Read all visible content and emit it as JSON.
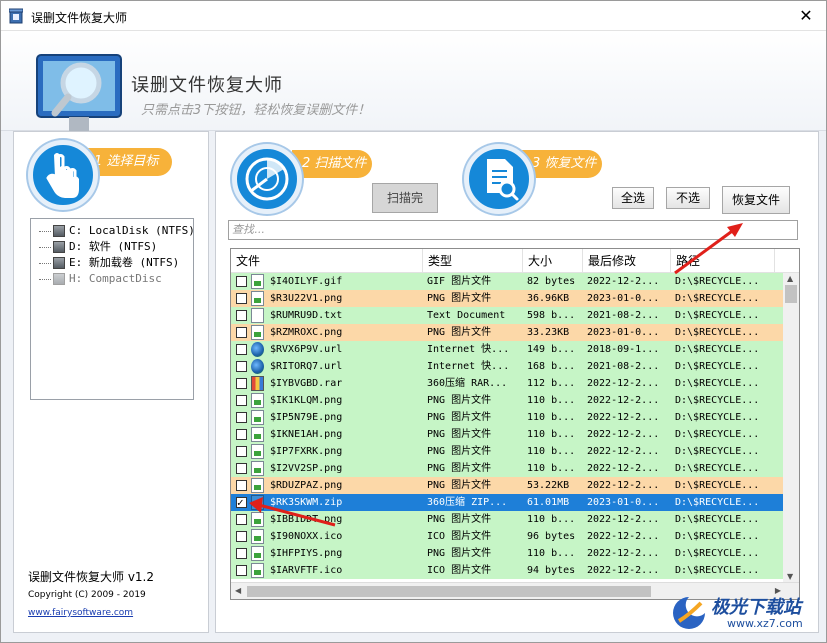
{
  "window": {
    "title": "误删文件恢复大师",
    "close_label": "✕"
  },
  "header": {
    "title": "误删文件恢复大师",
    "subtitle": "只需点击3下按钮，轻松恢复误删文件！"
  },
  "steps": {
    "step1": "1 选择目标",
    "step2": "2 扫描文件",
    "step3": "3 恢复文件"
  },
  "drives": [
    {
      "label": "C: LocalDisk (NTFS)",
      "enabled": true
    },
    {
      "label": "D: 软件 (NTFS)",
      "enabled": true
    },
    {
      "label": "E: 新加载卷 (NTFS)",
      "enabled": true
    },
    {
      "label": "H: CompactDisc",
      "enabled": false
    }
  ],
  "footer": {
    "name": "误删文件恢复大师 v1.2",
    "copyright": "Copyright (C) 2009 - 2019",
    "link": "www.fairysoftware.com"
  },
  "buttons": {
    "scan": "扫描完",
    "select_all": "全选",
    "select_none": "不选",
    "recover": "恢复文件"
  },
  "search": {
    "placeholder": "查找..."
  },
  "table": {
    "columns": [
      "文件",
      "类型",
      "大小",
      "最后修改",
      "路径"
    ],
    "rows": [
      {
        "name": "$I4OILYF.gif",
        "type": "GIF 图片文件",
        "size": "82 bytes",
        "modified": "2022-12-2...",
        "path": "D:\\$RECYCLE...",
        "color": "green",
        "icon": "img",
        "checked": false
      },
      {
        "name": "$R3U22V1.png",
        "type": "PNG 图片文件",
        "size": "36.96KB",
        "modified": "2023-01-0...",
        "path": "D:\\$RECYCLE...",
        "color": "orange",
        "icon": "img",
        "checked": false
      },
      {
        "name": "$RUMRU9D.txt",
        "type": "Text Document",
        "size": "598 b...",
        "modified": "2021-08-2...",
        "path": "D:\\$RECYCLE...",
        "color": "green",
        "icon": "txt",
        "checked": false
      },
      {
        "name": "$RZMROXC.png",
        "type": "PNG 图片文件",
        "size": "33.23KB",
        "modified": "2023-01-0...",
        "path": "D:\\$RECYCLE...",
        "color": "orange",
        "icon": "img",
        "checked": false
      },
      {
        "name": "$RVX6P9V.url",
        "type": "Internet 快...",
        "size": "149 b...",
        "modified": "2018-09-1...",
        "path": "D:\\$RECYCLE...",
        "color": "green",
        "icon": "url",
        "checked": false
      },
      {
        "name": "$RITORQ7.url",
        "type": "Internet 快...",
        "size": "168 b...",
        "modified": "2021-08-2...",
        "path": "D:\\$RECYCLE...",
        "color": "green",
        "icon": "url",
        "checked": false
      },
      {
        "name": "$IYBVGBD.rar",
        "type": "360压缩 RAR...",
        "size": "112 b...",
        "modified": "2022-12-2...",
        "path": "D:\\$RECYCLE...",
        "color": "green",
        "icon": "rar",
        "checked": false
      },
      {
        "name": "$IK1KLQM.png",
        "type": "PNG 图片文件",
        "size": "110 b...",
        "modified": "2022-12-2...",
        "path": "D:\\$RECYCLE...",
        "color": "green",
        "icon": "img",
        "checked": false
      },
      {
        "name": "$IP5N79E.png",
        "type": "PNG 图片文件",
        "size": "110 b...",
        "modified": "2022-12-2...",
        "path": "D:\\$RECYCLE...",
        "color": "green",
        "icon": "img",
        "checked": false
      },
      {
        "name": "$IKNE1AH.png",
        "type": "PNG 图片文件",
        "size": "110 b...",
        "modified": "2022-12-2...",
        "path": "D:\\$RECYCLE...",
        "color": "green",
        "icon": "img",
        "checked": false
      },
      {
        "name": "$IP7FXRK.png",
        "type": "PNG 图片文件",
        "size": "110 b...",
        "modified": "2022-12-2...",
        "path": "D:\\$RECYCLE...",
        "color": "green",
        "icon": "img",
        "checked": false
      },
      {
        "name": "$I2VV2SP.png",
        "type": "PNG 图片文件",
        "size": "110 b...",
        "modified": "2022-12-2...",
        "path": "D:\\$RECYCLE...",
        "color": "green",
        "icon": "img",
        "checked": false
      },
      {
        "name": "$RDUZPAZ.png",
        "type": "PNG 图片文件",
        "size": "53.22KB",
        "modified": "2022-12-2...",
        "path": "D:\\$RECYCLE...",
        "color": "orange",
        "icon": "img",
        "checked": false
      },
      {
        "name": "$RK3SKWM.zip",
        "type": "360压缩 ZIP...",
        "size": "61.01MB",
        "modified": "2023-01-0...",
        "path": "D:\\$RECYCLE...",
        "color": "sel",
        "icon": "zip",
        "checked": true
      },
      {
        "name": "$IBBIDDT.png",
        "type": "PNG 图片文件",
        "size": "110 b...",
        "modified": "2022-12-2...",
        "path": "D:\\$RECYCLE...",
        "color": "green",
        "icon": "img",
        "checked": false
      },
      {
        "name": "$I90NOXX.ico",
        "type": "ICO 图片文件",
        "size": "96 bytes",
        "modified": "2022-12-2...",
        "path": "D:\\$RECYCLE...",
        "color": "green",
        "icon": "img",
        "checked": false
      },
      {
        "name": "$IHFPIYS.png",
        "type": "PNG 图片文件",
        "size": "110 b...",
        "modified": "2022-12-2...",
        "path": "D:\\$RECYCLE...",
        "color": "green",
        "icon": "img",
        "checked": false
      },
      {
        "name": "$IARVFTF.ico",
        "type": "ICO 图片文件",
        "size": "94 bytes",
        "modified": "2022-12-2...",
        "path": "D:\\$RECYCLE...",
        "color": "green",
        "icon": "img",
        "checked": false
      }
    ]
  },
  "watermark": {
    "text": "极光下载站",
    "url": "www.xz7.com"
  }
}
